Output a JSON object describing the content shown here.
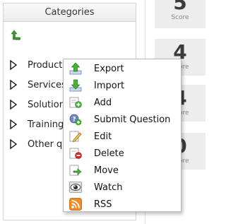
{
  "categories": {
    "title": "Categories",
    "items": [
      {
        "label": "Products"
      },
      {
        "label": "Services"
      },
      {
        "label": "Solutions"
      },
      {
        "label": "Training"
      },
      {
        "label": "Other q"
      }
    ]
  },
  "scores": [
    {
      "value": "5",
      "label": "Score"
    },
    {
      "value": "4",
      "label": "Score"
    },
    {
      "value": "4",
      "label": "Score"
    },
    {
      "value": "0",
      "label": "Score"
    }
  ],
  "context_menu": {
    "items": [
      {
        "label": "Export",
        "icon": "export-icon"
      },
      {
        "label": "Import",
        "icon": "import-icon"
      },
      {
        "label": "Add",
        "icon": "add-icon"
      },
      {
        "label": "Submit Question",
        "icon": "submit-question-icon"
      },
      {
        "label": "Edit",
        "icon": "edit-icon"
      },
      {
        "label": "Delete",
        "icon": "delete-icon"
      },
      {
        "label": "Move",
        "icon": "move-icon"
      },
      {
        "label": "Watch",
        "icon": "watch-icon"
      },
      {
        "label": "RSS",
        "icon": "rss-icon"
      }
    ]
  },
  "colors": {
    "icon_green": "#3a9b2a",
    "icon_red": "#d42a2a",
    "rss_orange": "#f08a24",
    "score_bg": "#ededed"
  }
}
